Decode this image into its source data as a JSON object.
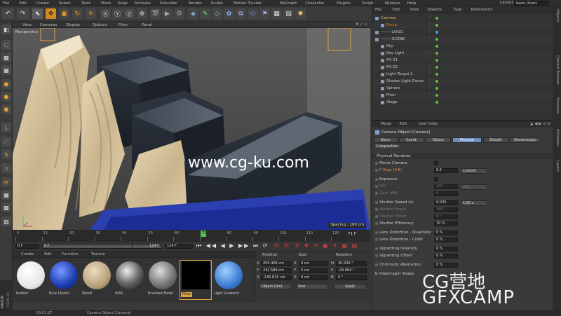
{
  "menu": [
    "File",
    "Edit",
    "Create",
    "Select",
    "Tools",
    "Mesh",
    "Snap",
    "Animate",
    "Simulate",
    "Render",
    "Sculpt",
    "Motion Tracker",
    "MoGraph",
    "Character",
    "Plugins",
    "Script",
    "Window",
    "Help"
  ],
  "layout": {
    "label": "Layout:",
    "value": "team (User)"
  },
  "viewport": {
    "menu": [
      "View",
      "Cameras",
      "Display",
      "Options",
      "Filter",
      "Panel"
    ],
    "label": "Perspective",
    "spacing": "Spacing : 100 cm"
  },
  "watermark": {
    "text": "www.cg-ku.com",
    "brand1": "CG营地",
    "brand2": "GFXCAMP"
  },
  "timeline": {
    "ticks": [
      "0",
      "10",
      "20",
      "30",
      "40",
      "50",
      "60",
      "70",
      "80",
      "90",
      "100",
      "110",
      "120"
    ],
    "current": "71",
    "end_label": "71 F"
  },
  "transport": {
    "start": "0 F",
    "start2": "0 F",
    "end": "124 F",
    "end2": "124 F"
  },
  "materials": {
    "menu": [
      "Create",
      "Edit",
      "Function",
      "Texture"
    ],
    "items": [
      "Reflect",
      "Blue Plastic",
      "Wood",
      "HDR",
      "Brushed Metal",
      "Floor",
      "Light Gradient"
    ]
  },
  "coords": {
    "headers": [
      "Position",
      "Size",
      "Rotation"
    ],
    "rows": [
      {
        "axis": "X",
        "pos": "450.406 cm",
        "sax": "X",
        "size": "0 cm",
        "rax": "H",
        "rot": "30.209 °"
      },
      {
        "axis": "Y",
        "pos": "242.589 cm",
        "sax": "Y",
        "size": "0 cm",
        "rax": "P",
        "rot": "-29.064 °"
      },
      {
        "axis": "Z",
        "pos": "-136.815 cm",
        "sax": "Z",
        "size": "0 cm",
        "rax": "B",
        "rot": "0 °"
      }
    ],
    "mode": "Object (Rel)",
    "size_mode": "Size",
    "apply": "Apply"
  },
  "objects": {
    "menu": [
      "File",
      "Edit",
      "View",
      "Objects",
      "Tags",
      "Bookmarks"
    ],
    "items": [
      {
        "name": "Camera",
        "indent": 0,
        "color": "#e8c26a"
      },
      {
        "name": "Focus",
        "indent": 1,
        "color": "#e07a2a"
      },
      {
        "name": "--------LOGO",
        "indent": 0,
        "color": "#c8c8c8"
      },
      {
        "name": "--------SCENE",
        "indent": 0,
        "color": "#c8c8c8"
      },
      {
        "name": "Sky",
        "indent": 1,
        "color": "#c8c8c8"
      },
      {
        "name": "Key Light",
        "indent": 1,
        "color": "#c8c8c8"
      },
      {
        "name": "Fill 01",
        "indent": 1,
        "color": "#c8c8c8"
      },
      {
        "name": "Fill 02",
        "indent": 1,
        "color": "#c8c8c8"
      },
      {
        "name": "Light.Target.1",
        "indent": 1,
        "color": "#c8c8c8"
      },
      {
        "name": "Shader Light Dome",
        "indent": 1,
        "color": "#c8c8c8"
      },
      {
        "name": "Sphere",
        "indent": 1,
        "color": "#c8c8c8"
      },
      {
        "name": "Floor",
        "indent": 1,
        "color": "#c8c8c8"
      },
      {
        "name": "Stage",
        "indent": 1,
        "color": "#c8c8c8"
      }
    ]
  },
  "attributes": {
    "menu": [
      "Mode",
      "Edit",
      "User Data"
    ],
    "title": "Camera Object [Camera]",
    "tabs": [
      "Basic",
      "Coord.",
      "Object",
      "Physical",
      "Details",
      "Stereoscopic",
      "Composition"
    ],
    "active_tab": "Physical",
    "section": "Physical Renderer",
    "rows": [
      {
        "label": "Movie Camera",
        "value": "",
        "extra": ""
      },
      {
        "label": "F-Stop (f/#)",
        "value": "0.2",
        "extra": "Custom"
      },
      {
        "label": "Exposure",
        "value": "",
        "extra": ""
      },
      {
        "label": "ISO",
        "value": "100",
        "extra": "200"
      },
      {
        "label": "Gain (dB)",
        "value": "0",
        "extra": ""
      },
      {
        "label": "Shutter Speed (s)",
        "value": "0.033",
        "extra": "1/30 s"
      },
      {
        "label": "Shutter Angle",
        "value": "180 °",
        "extra": ""
      },
      {
        "label": "Shutter Offset",
        "value": "0 °",
        "extra": ""
      },
      {
        "label": "Shutter Efficiency",
        "value": "70 %",
        "extra": ""
      },
      {
        "label": "Lens Distortion - Quadratic",
        "value": "0 %",
        "extra": ""
      },
      {
        "label": "Lens Distortion - Cubic",
        "value": "0 %",
        "extra": ""
      },
      {
        "label": "Vignetting Intensity",
        "value": "0 %",
        "extra": ""
      },
      {
        "label": "Vignetting Offset",
        "value": "0 %",
        "extra": ""
      },
      {
        "label": "Chromatic Aberration",
        "value": "0 %",
        "extra": ""
      },
      {
        "label": "Diaphragm Shape",
        "value": "",
        "extra": ""
      }
    ]
  },
  "sidetabs": [
    "Objects",
    "Content Browser",
    "Structure",
    "Attributes",
    "Layers"
  ],
  "status": {
    "time": "00:01:27",
    "text": "Camera Object [Camera]"
  },
  "brand": {
    "name": "MAXON",
    "product": "CINEMA 4D"
  }
}
